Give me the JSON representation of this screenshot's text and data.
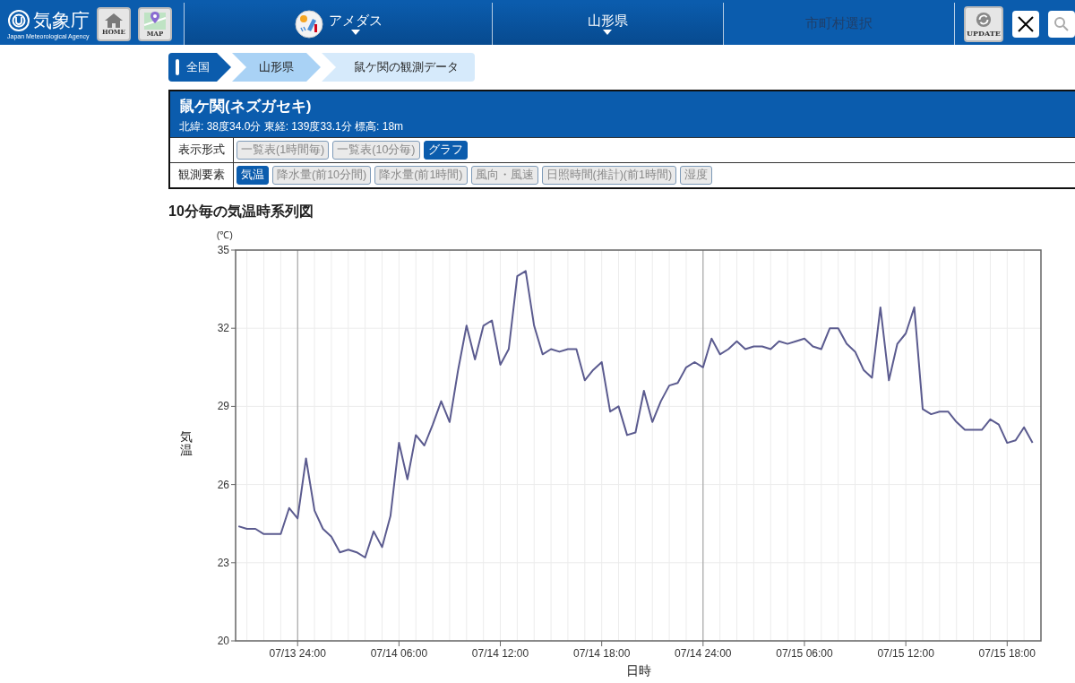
{
  "header": {
    "agency": {
      "name": "気象庁",
      "english": "Japan Meteorological Agency"
    },
    "buttons": [
      {
        "label": "HOME",
        "kind": "home"
      },
      {
        "label": "MAP",
        "kind": "map"
      }
    ],
    "nav": [
      {
        "label": "アメダス",
        "kind": "amedas",
        "dropdown": true,
        "disabled": false
      },
      {
        "label": "山形県",
        "kind": "plain",
        "dropdown": true,
        "disabled": false
      },
      {
        "label": "市町村選択",
        "kind": "plain",
        "dropdown": false,
        "disabled": true
      }
    ],
    "tools": [
      {
        "label": "UPDATE"
      }
    ]
  },
  "breadcrumb": [
    {
      "label": "全国"
    },
    {
      "label": "山形県"
    },
    {
      "label": "鼠ケ関の観測データ"
    }
  ],
  "station": {
    "name": "鼠ケ関(ネズガセキ)",
    "location": "北緯: 38度34.0分 東経: 139度33.1分 標高: 18m",
    "rows": [
      {
        "label": "表示形式",
        "options": [
          {
            "label": "一覧表(1時間毎)",
            "selected": false
          },
          {
            "label": "一覧表(10分毎)",
            "selected": false
          },
          {
            "label": "グラフ",
            "selected": true
          }
        ]
      },
      {
        "label": "観測要素",
        "options": [
          {
            "label": "気温",
            "selected": true
          },
          {
            "label": "降水量(前10分間)",
            "selected": false
          },
          {
            "label": "降水量(前1時間)",
            "selected": false
          },
          {
            "label": "風向・風速",
            "selected": false
          },
          {
            "label": "日照時間(推計)(前1時間)",
            "selected": false
          },
          {
            "label": "湿度",
            "selected": false
          }
        ]
      }
    ]
  },
  "chart": {
    "unit_label": "(℃)",
    "chart_data": {
      "type": "line",
      "grid": true,
      "title": "10分毎の気温時系列図",
      "xlabel": "日時",
      "ylabel": "気温",
      "categories": [
        null,
        null,
        null,
        null,
        null,
        null,
        null,
        "07/13 24:00",
        null,
        null,
        null,
        null,
        null,
        null,
        null,
        null,
        null,
        null,
        null,
        "07/14 06:00",
        null,
        null,
        null,
        null,
        null,
        null,
        null,
        null,
        null,
        null,
        null,
        "07/14 12:00",
        null,
        null,
        null,
        null,
        null,
        null,
        null,
        null,
        null,
        null,
        null,
        "07/14 18:00",
        null,
        null,
        null,
        null,
        null,
        null,
        null,
        null,
        null,
        null,
        null,
        "07/14 24:00",
        null,
        null,
        null,
        null,
        null,
        null,
        null,
        null,
        null,
        null,
        null,
        "07/15 06:00",
        null,
        null,
        null,
        null,
        null,
        null,
        null,
        null,
        null,
        null,
        null,
        "07/15 12:00",
        null,
        null,
        null,
        null,
        null,
        null,
        null,
        null,
        null,
        null,
        null,
        "07/15 18:00",
        null,
        null,
        null
      ],
      "series": [
        {
          "color": "#5b5b8f",
          "values": [
            24.4,
            24.3,
            24.3,
            24.1,
            24.1,
            24.1,
            25.1,
            24.7,
            27.0,
            25.0,
            24.3,
            24.0,
            23.4,
            23.5,
            23.4,
            23.2,
            24.2,
            23.6,
            24.8,
            27.6,
            26.2,
            27.9,
            27.5,
            28.3,
            29.2,
            28.4,
            30.4,
            32.1,
            30.8,
            32.1,
            32.3,
            30.6,
            31.2,
            34.0,
            34.2,
            32.1,
            31.0,
            31.2,
            31.1,
            31.2,
            31.2,
            30.0,
            30.4,
            30.7,
            28.8,
            29.0,
            27.9,
            28.0,
            29.6,
            28.4,
            29.2,
            29.8,
            29.9,
            30.5,
            30.7,
            30.5,
            31.6,
            31.0,
            31.2,
            31.5,
            31.2,
            31.3,
            31.3,
            31.2,
            31.5,
            31.4,
            31.5,
            31.6,
            31.3,
            31.2,
            32.0,
            32.0,
            31.4,
            31.1,
            30.4,
            30.1,
            32.8,
            30.0,
            31.4,
            31.8,
            32.8,
            28.9,
            28.7,
            28.8,
            28.8,
            28.4,
            28.1,
            28.1,
            28.1,
            28.5,
            28.3,
            27.6,
            27.7,
            28.2,
            27.6
          ]
        }
      ],
      "ylim": [
        20,
        35
      ],
      "yticks": [
        20,
        23,
        26,
        29,
        32,
        35
      ]
    }
  }
}
